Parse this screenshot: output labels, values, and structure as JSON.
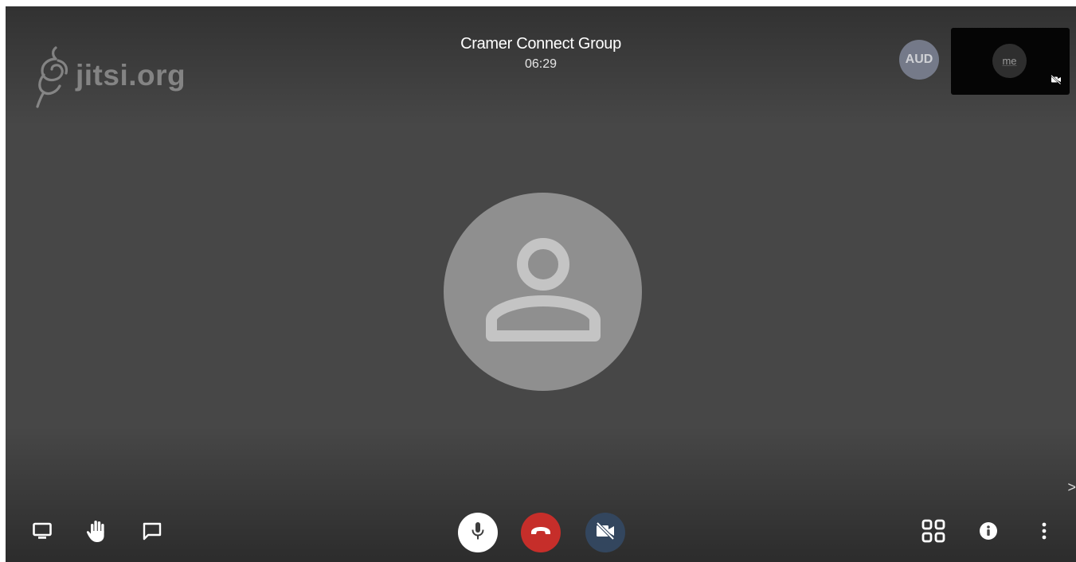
{
  "watermark": {
    "text": "jitsi.org",
    "icon": "jitsi-logo-icon"
  },
  "conference": {
    "name": "Cramer Connect Group",
    "timer": "06:29"
  },
  "participants": {
    "remote_badge": "AUD",
    "local_label": "me",
    "local_video_muted_icon": "camera-off-icon",
    "main_avatar_icon": "person-icon"
  },
  "toolbar": {
    "left": [
      {
        "name": "share-screen",
        "icon": "monitor-icon"
      },
      {
        "name": "raise-hand",
        "icon": "hand-icon"
      },
      {
        "name": "chat",
        "icon": "chat-bubble-icon"
      }
    ],
    "center": [
      {
        "name": "microphone",
        "icon": "microphone-icon",
        "color": "#ffffff"
      },
      {
        "name": "hangup",
        "icon": "phone-hangup-icon",
        "color": "#c62e2a"
      },
      {
        "name": "camera",
        "icon": "camera-off-icon",
        "color": "#33465e"
      }
    ],
    "right": [
      {
        "name": "tile-view",
        "icon": "grid-icon"
      },
      {
        "name": "info",
        "icon": "info-icon"
      },
      {
        "name": "more",
        "icon": "more-vertical-icon"
      }
    ]
  },
  "filmstrip_toggle": {
    "icon": "chevron-right-icon",
    "label": ">"
  },
  "colors": {
    "stage_background": "#474747",
    "avatar_background": "#8f8f8f",
    "avatar_foreground": "#c4c4c4",
    "hangup": "#c62e2a",
    "camera_button": "#33465e",
    "remote_badge": "#7f8597"
  }
}
